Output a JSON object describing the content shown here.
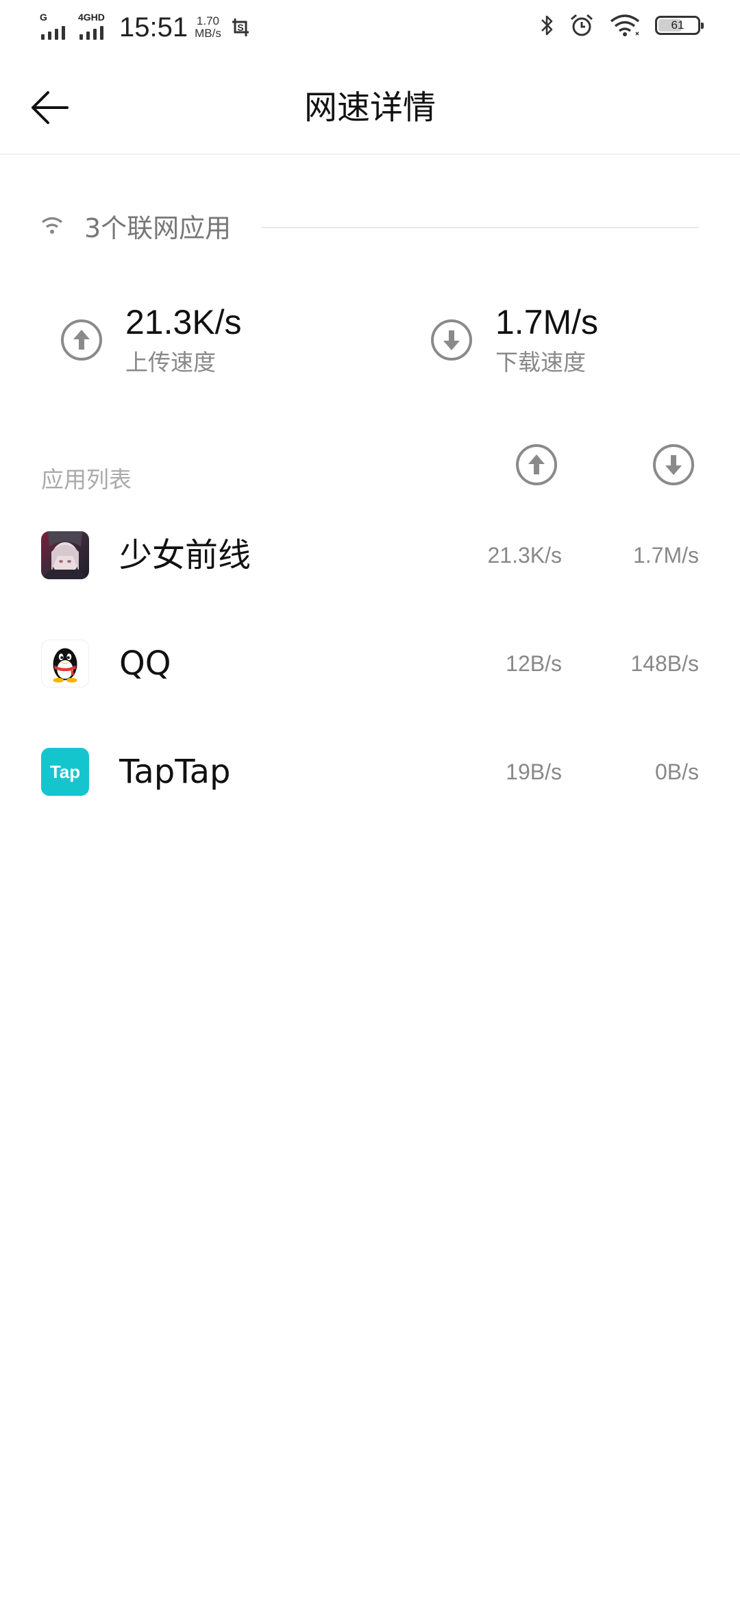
{
  "status_bar": {
    "network1": "G",
    "network2": "4GHD",
    "time": "15:51",
    "speed_value": "1.70",
    "speed_unit": "MB/s",
    "battery_level": "61",
    "battery_fraction": 0.61,
    "icons": [
      "screenshot-icon",
      "bluetooth-icon",
      "alarm-icon",
      "wifi-icon",
      "battery-icon"
    ]
  },
  "header": {
    "title": "网速详情",
    "back_icon": "arrow-left-icon"
  },
  "summary": {
    "app_count_label": "3个联网应用",
    "upload": {
      "value": "21.3K/s",
      "label": "上传速度",
      "icon": "upload-arrow-icon"
    },
    "download": {
      "value": "1.7M/s",
      "label": "下载速度",
      "icon": "download-arrow-icon"
    }
  },
  "app_list": {
    "title": "应用列表",
    "column_icons": [
      "upload-arrow-icon",
      "download-arrow-icon"
    ],
    "apps": [
      {
        "name": "少女前线",
        "upload": "21.3K/s",
        "download": "1.7M/s",
        "icon": "girls-frontline-icon"
      },
      {
        "name": "QQ",
        "upload": "12B/s",
        "download": "148B/s",
        "icon": "qq-penguin-icon"
      },
      {
        "name": "TapTap",
        "upload": "19B/s",
        "download": "0B/s",
        "icon": "taptap-icon",
        "icon_text": "Tap",
        "icon_color": "#15c5ce"
      }
    ]
  },
  "colors": {
    "background": "#ffffff",
    "text_primary": "#111111",
    "text_secondary": "#888888",
    "icon_gray": "#8a8a8a",
    "taptap_brand": "#15c5ce"
  }
}
